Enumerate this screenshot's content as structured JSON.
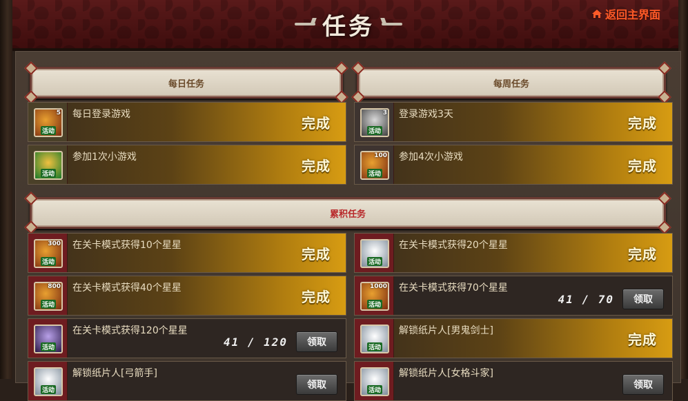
{
  "header": {
    "title": "任务",
    "home_link": "返回主界面"
  },
  "sections": {
    "daily": "每日任务",
    "weekly": "每周任务",
    "cumulative": "累积任务"
  },
  "daily_tasks": [
    {
      "name": "每日登录游戏",
      "status": "完成",
      "qty": "5",
      "tag": "活动",
      "icon": "fire-icon"
    },
    {
      "name": "参加1次小游戏",
      "status": "完成",
      "qty": "",
      "tag": "活动",
      "icon": "gift-icon"
    }
  ],
  "weekly_tasks": [
    {
      "name": "登录游戏3天",
      "status": "完成",
      "qty": "3",
      "tag": "活动",
      "icon": "sword-icon"
    },
    {
      "name": "参加4次小游戏",
      "status": "完成",
      "qty": "100",
      "tag": "活动",
      "icon": "fire-icon"
    }
  ],
  "cumulative_tasks": [
    {
      "name": "在关卡模式获得10个星星",
      "status": "完成",
      "qty": "300",
      "tag": "活动",
      "icon": "fire-icon"
    },
    {
      "name": "在关卡模式获得20个星星",
      "status": "完成",
      "qty": "",
      "tag": "活动",
      "icon": "mystery-icon"
    },
    {
      "name": "在关卡模式获得40个星星",
      "status": "完成",
      "qty": "800",
      "tag": "活动",
      "icon": "fire-icon"
    },
    {
      "name": "在关卡模式获得70个星星",
      "progress": "41 / 70",
      "button": "领取",
      "qty": "1000",
      "tag": "活动",
      "icon": "fire-icon"
    },
    {
      "name": "在关卡模式获得120个星星",
      "progress": "41 / 120",
      "button": "领取",
      "qty": "",
      "tag": "活动",
      "icon": "character-icon"
    },
    {
      "name": "解锁纸片人[男鬼剑士]",
      "status": "完成",
      "qty": "",
      "tag": "活动",
      "icon": "character-icon"
    },
    {
      "name": "解锁纸片人[弓箭手]",
      "button": "领取",
      "qty": "",
      "tag": "活动",
      "icon": "character-icon"
    },
    {
      "name": "解锁纸片人[女格斗家]",
      "button": "领取",
      "qty": "",
      "tag": "活动",
      "icon": "character-icon"
    }
  ],
  "colors": {
    "header_bg": "#4a1414",
    "done_gold": "#d79c12",
    "home_link": "#ff5a28"
  }
}
